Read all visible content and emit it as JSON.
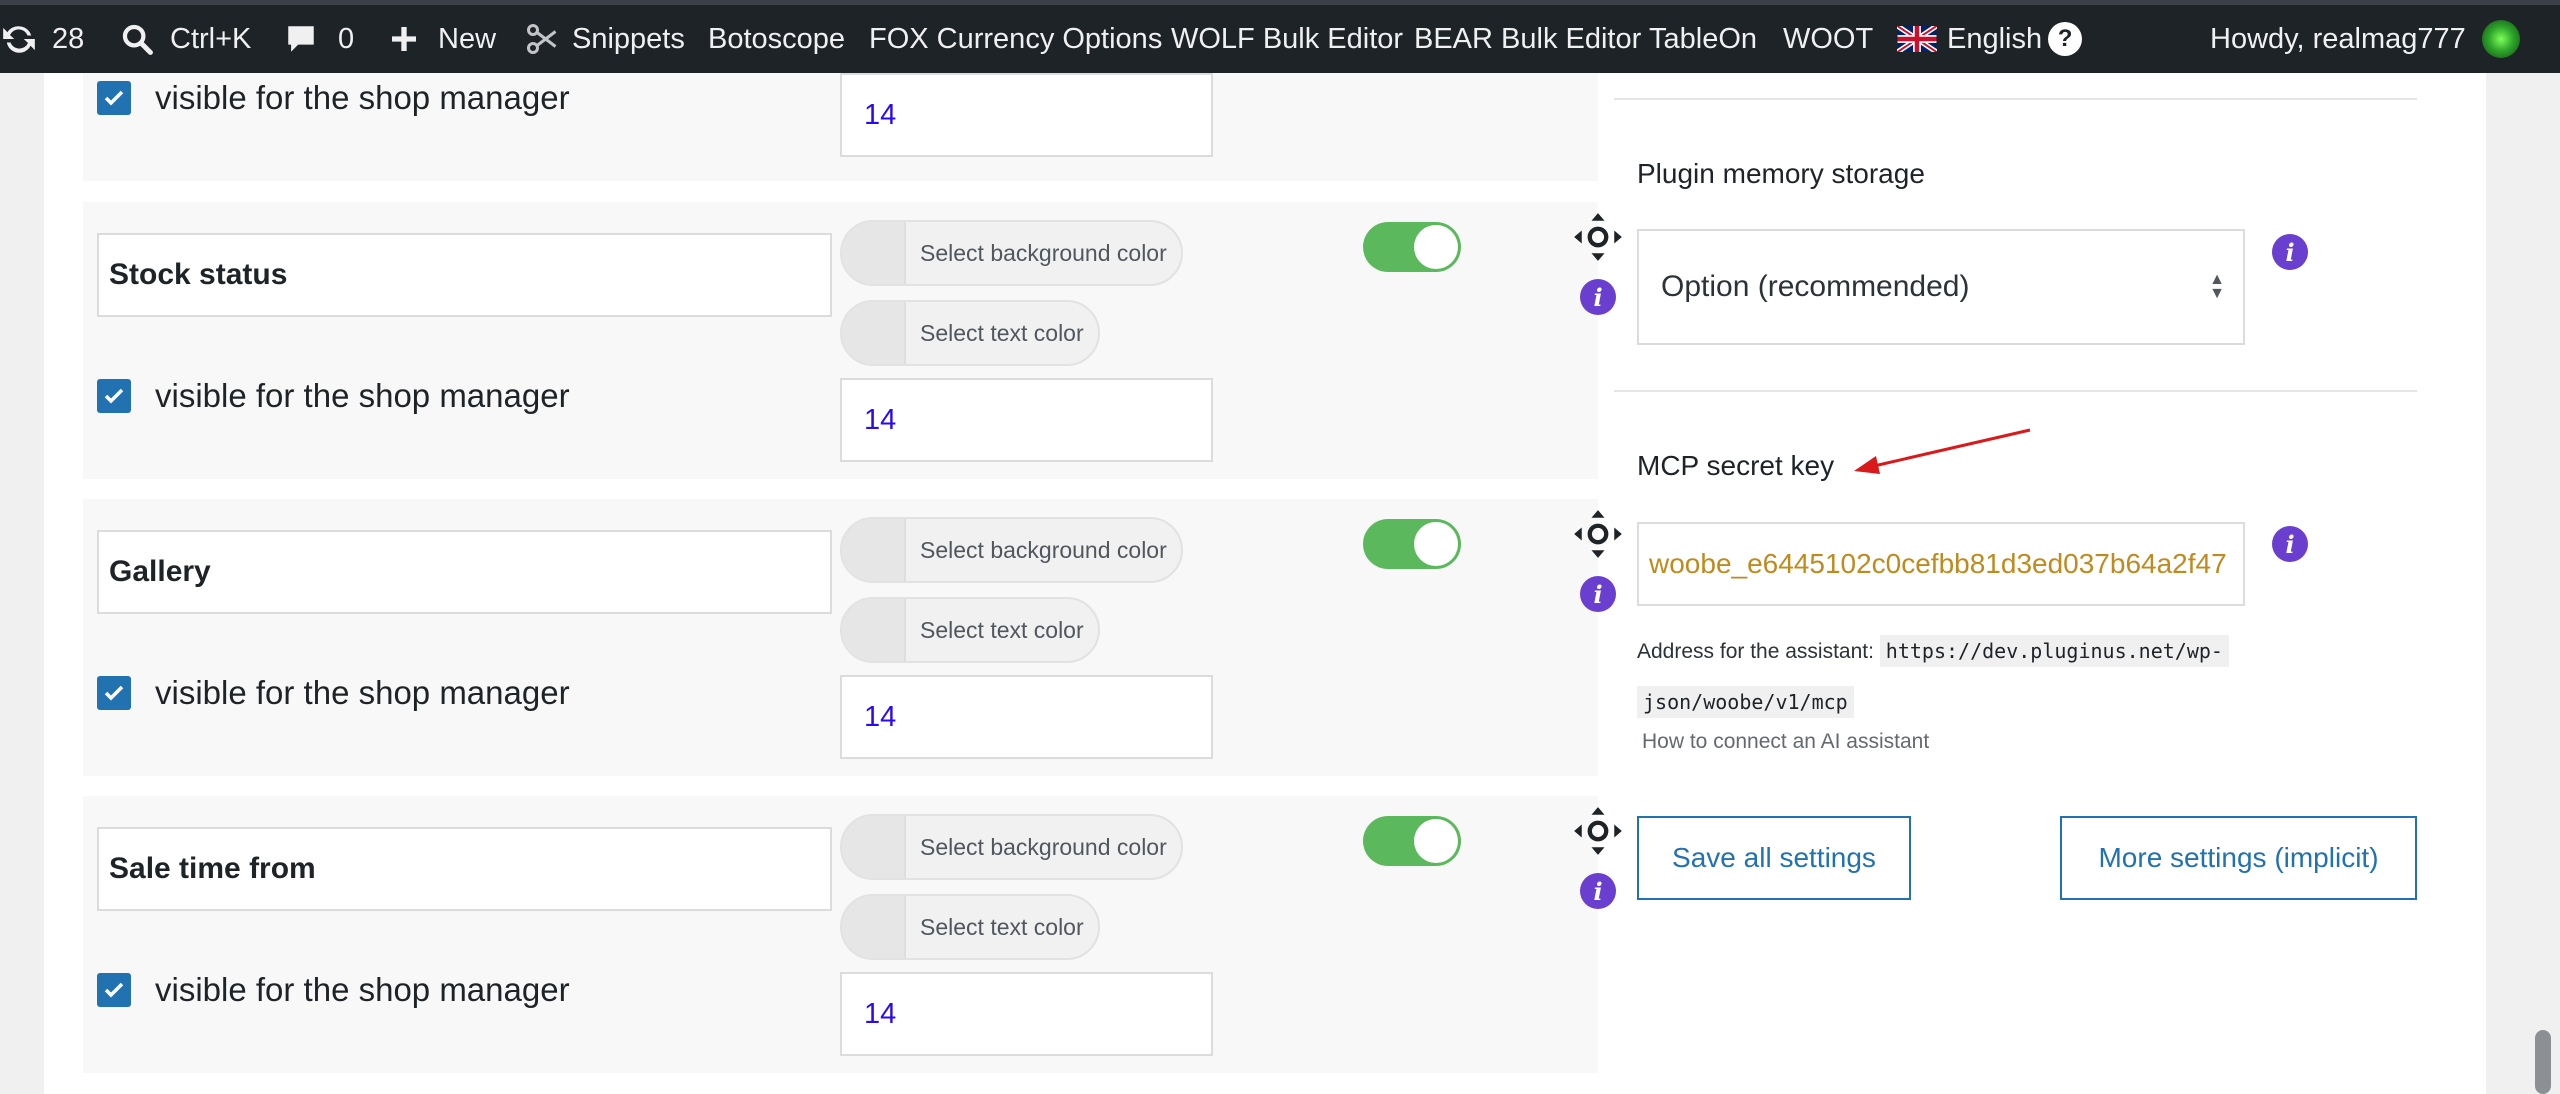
{
  "admin_bar": {
    "updates_count": "28",
    "search_shortcut": "Ctrl+K",
    "comments_count": "0",
    "new_label": "New",
    "snippets_label": "Snippets",
    "menu_items": [
      "Botoscope",
      "FOX Currency Options",
      "WOLF Bulk Editor",
      "BEAR Bulk Editor",
      "TableOn",
      "WOOT"
    ],
    "language_label": "English",
    "help_label": "?",
    "howdy": "Howdy, realmag777"
  },
  "field_rows": {
    "top_partial": {
      "visible_label": "visible for the shop manager",
      "font_size": "14"
    },
    "rows": [
      {
        "name": "Stock status",
        "bg_color_label": "Select background color",
        "text_color_label": "Select text color",
        "visible_label": "visible for the shop manager",
        "font_size": "14"
      },
      {
        "name": "Gallery",
        "bg_color_label": "Select background color",
        "text_color_label": "Select text color",
        "visible_label": "visible for the shop manager",
        "font_size": "14"
      },
      {
        "name": "Sale time from",
        "bg_color_label": "Select background color",
        "text_color_label": "Select text color",
        "visible_label": "visible for the shop manager",
        "font_size": "14"
      }
    ]
  },
  "settings_panel": {
    "storage_label": "Plugin memory storage",
    "storage_value": "Option (recommended)",
    "mcp_label": "MCP secret key",
    "mcp_value": "woobe_e6445102c0cefbb81d3ed037b64a2f47",
    "address_label": "Address for the assistant:",
    "address_value_1": "https://dev.pluginus.net/wp-",
    "address_value_2": "json/woobe/v1/mcp",
    "howto_link": "How to connect an AI assistant",
    "save_button": "Save all settings",
    "more_button": "More settings (implicit)"
  },
  "colors": {
    "accent": "#2271b1",
    "toggle_on": "#5cb85c",
    "info_icon": "#6a3fd0",
    "annotation_arrow": "#d9191a",
    "key_text": "#c08a1e"
  }
}
